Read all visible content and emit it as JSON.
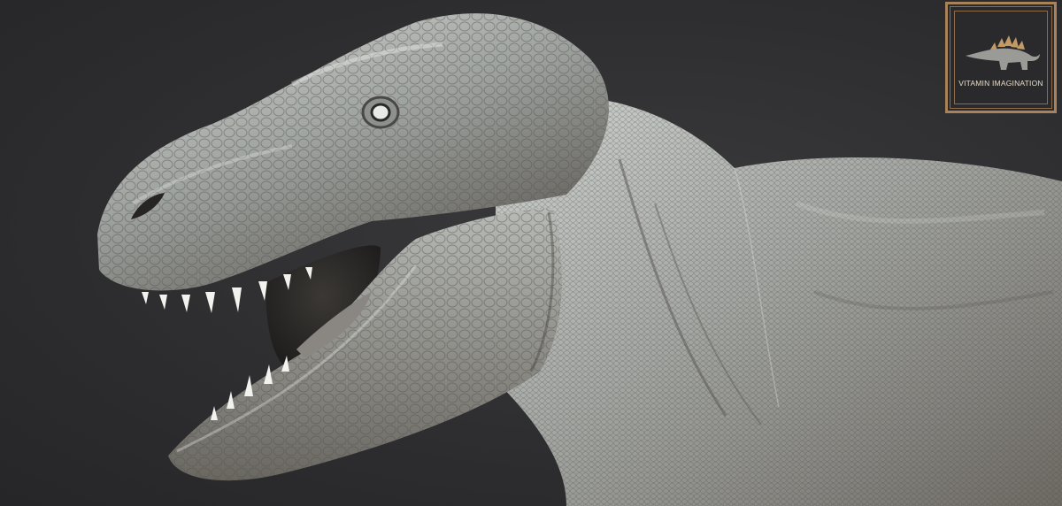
{
  "image": {
    "subject": "",
    "background_color": "#2f2f31",
    "skin_color": "#a8aaa6"
  },
  "logo": {
    "text": "VITAMIN IMAGINATION",
    "frame_color": "#a9825a",
    "icon": "stegosaurus-icon"
  }
}
